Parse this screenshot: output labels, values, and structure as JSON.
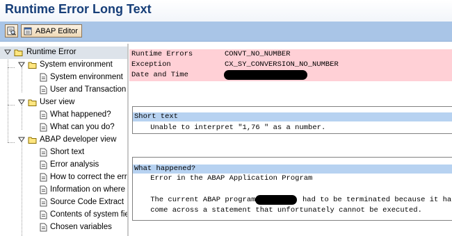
{
  "window": {
    "title": "Runtime Error Long Text"
  },
  "toolbar": {
    "editor_label": "ABAP Editor",
    "icon1": "display-document-icon",
    "icon2": "abap-editor-icon"
  },
  "tree": {
    "root": "Runtime Error",
    "groups": [
      {
        "label": "System environment",
        "items": [
          "System environment",
          "User and Transaction"
        ]
      },
      {
        "label": "User view",
        "items": [
          "What happened?",
          "What can you do?"
        ]
      },
      {
        "label": "ABAP developer view",
        "items": [
          "Short text",
          "Error analysis",
          "How to correct the error",
          "Information on where terminated",
          "Source Code Extract",
          "Contents of system fields",
          "Chosen variables"
        ]
      }
    ]
  },
  "header": {
    "rows": [
      {
        "label": "Runtime Errors",
        "value": "CONVT_NO_NUMBER"
      },
      {
        "label": "Exception",
        "value": "CX_SY_CONVERSION_NO_NUMBER"
      },
      {
        "label": "Date and Time",
        "value": ""
      }
    ]
  },
  "short_text": {
    "title": "Short text",
    "line": "    Unable to interpret \"1,76 \" as a number."
  },
  "what_happened": {
    "title": "What happened?",
    "line1": "    Error in the ABAP Application Program",
    "line2_pre": "    The current ABAP program",
    "line2_post": "had to be terminated because it has",
    "line3": "    come across a statement that unfortunately cannot be executed."
  }
}
